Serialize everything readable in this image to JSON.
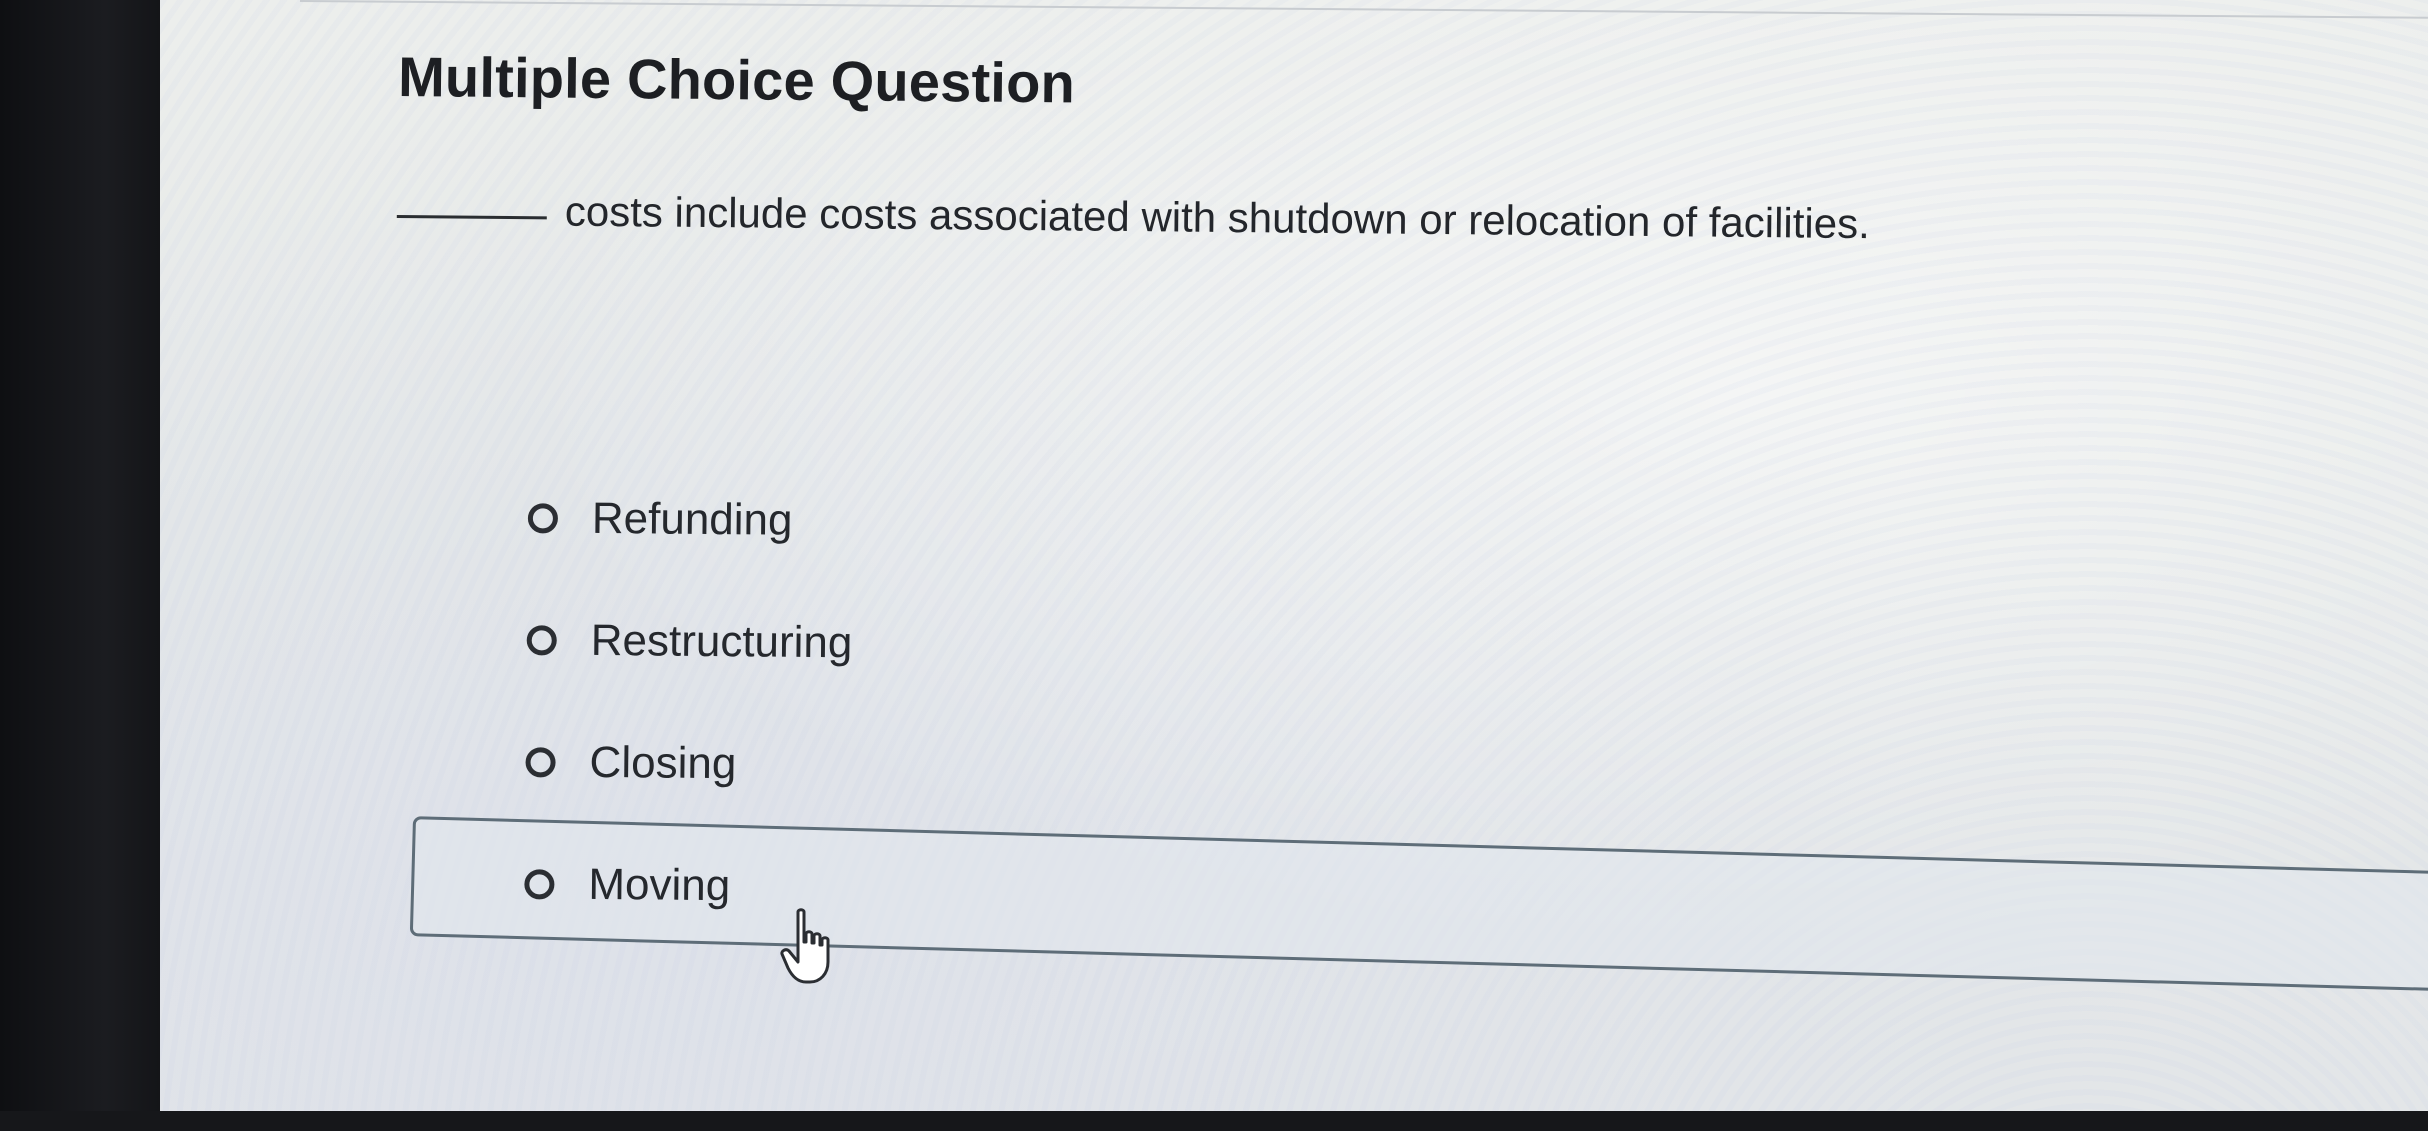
{
  "question": {
    "heading": "Multiple Choice Question",
    "prompt_text": "costs include costs associated with shutdown or relocation of facilities.",
    "options": [
      {
        "label": "Refunding"
      },
      {
        "label": "Restructuring"
      },
      {
        "label": "Closing"
      },
      {
        "label": "Moving"
      }
    ],
    "hovered_option": "Moving"
  },
  "icons": {
    "radio": "radio-button-empty-icon",
    "cursor": "hand-pointer-icon"
  },
  "colors": {
    "text": "#1d1f23",
    "hover_border": "#5e6d78"
  }
}
